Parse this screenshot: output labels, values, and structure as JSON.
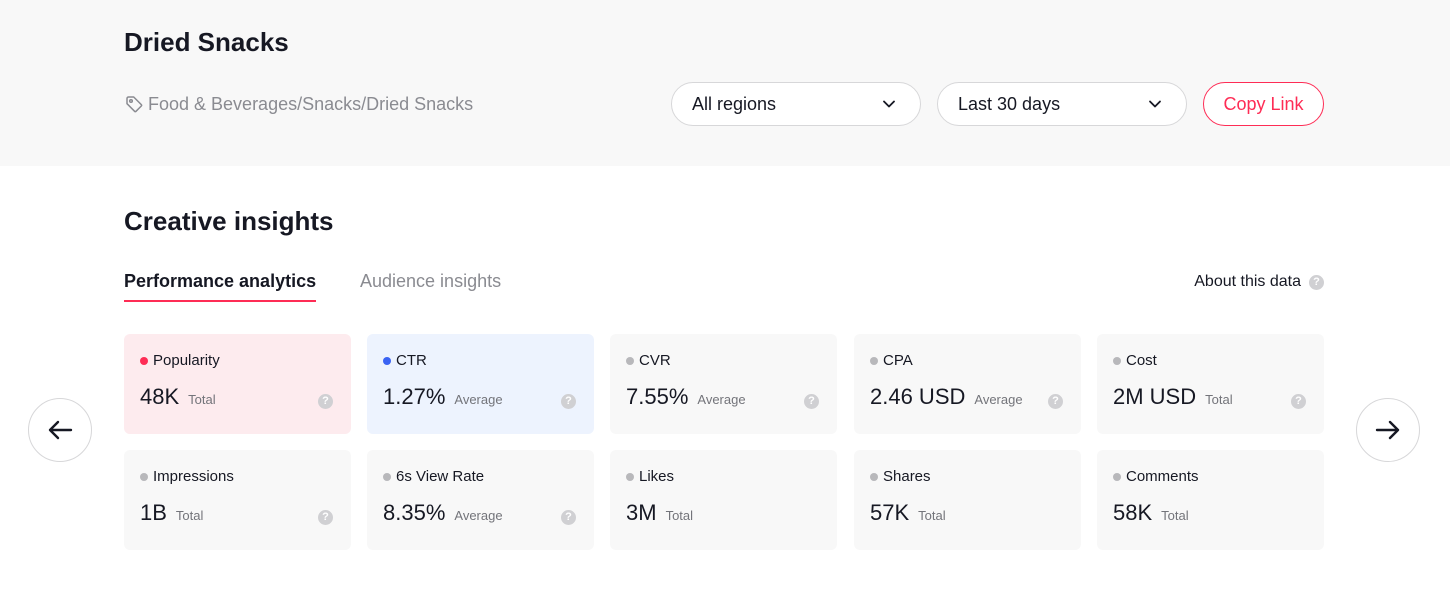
{
  "header": {
    "title": "Dried Snacks",
    "breadcrumb": "Food & Beverages/Snacks/Dried Snacks",
    "region_select": "All regions",
    "period_select": "Last 30 days",
    "copy_link_label": "Copy Link"
  },
  "section": {
    "title": "Creative insights",
    "tabs": [
      {
        "label": "Performance analytics",
        "active": true
      },
      {
        "label": "Audience insights",
        "active": false
      }
    ],
    "about_label": "About this data",
    "help_glyph": "?"
  },
  "colors": {
    "accent": "#fe2c55",
    "popularity_dot": "#fe2c55",
    "ctr_dot": "#3a63f3",
    "neutral_dot": "#b8b8bb"
  },
  "metrics": [
    {
      "label": "Popularity",
      "value": "48K",
      "unit": "Total",
      "dot_color": "#fe2c55",
      "tint": "pink"
    },
    {
      "label": "CTR",
      "value": "1.27%",
      "unit": "Average",
      "dot_color": "#3a63f3",
      "tint": "blue"
    },
    {
      "label": "CVR",
      "value": "7.55%",
      "unit": "Average",
      "dot_color": "#b8b8bb",
      "tint": "none"
    },
    {
      "label": "CPA",
      "value": "2.46 USD",
      "unit": "Average",
      "dot_color": "#b8b8bb",
      "tint": "none"
    },
    {
      "label": "Cost",
      "value": "2M USD",
      "unit": "Total",
      "dot_color": "#b8b8bb",
      "tint": "none"
    },
    {
      "label": "Impressions",
      "value": "1B",
      "unit": "Total",
      "dot_color": "#b8b8bb",
      "tint": "none"
    },
    {
      "label": "6s View Rate",
      "value": "8.35%",
      "unit": "Average",
      "dot_color": "#b8b8bb",
      "tint": "none"
    },
    {
      "label": "Likes",
      "value": "3M",
      "unit": "Total",
      "dot_color": "#b8b8bb",
      "tint": "none"
    },
    {
      "label": "Shares",
      "value": "57K",
      "unit": "Total",
      "dot_color": "#b8b8bb",
      "tint": "none"
    },
    {
      "label": "Comments",
      "value": "58K",
      "unit": "Total",
      "dot_color": "#b8b8bb",
      "tint": "none"
    }
  ],
  "icons": {
    "tag": "tag-icon",
    "chevron": "chevron-down-icon",
    "help": "help-icon",
    "prev": "arrow-left-icon",
    "next": "arrow-right-icon"
  }
}
